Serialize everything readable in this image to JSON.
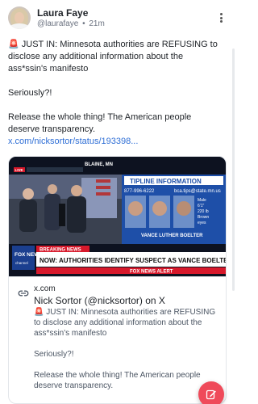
{
  "post": {
    "author_name": "Laura Faye",
    "handle": "@laurafaye",
    "separator": "•",
    "time": "21m",
    "body": [
      "🚨 JUST IN: Minnesota authorities are REFUSING to disclose any additional information about the ass*ssin's manifesto",
      "Seriously?!",
      "Release the whole thing! The American people deserve transparency."
    ],
    "link_text": "x.com/nicksortor/status/193398..."
  },
  "card": {
    "thumbnail": {
      "location": "BLAINE, MN",
      "live_badge": "LIVE",
      "panel_title": "TIPLINE INFORMATION",
      "phone": "877-996-6222",
      "email": "bca.tips@state.mn.us",
      "stats": [
        "Male",
        "6'1\"",
        "220 lb",
        "Brown",
        "eyes"
      ],
      "suspect_name": "VANCE LUTHER BOELTER",
      "breaking_label": "BREAKING NEWS",
      "headline": "NOW: AUTHORITIES IDENTIFY SUSPECT AS VANCE BOELTER",
      "network": "FOX NEWS",
      "channel": "channel",
      "alert": "FOX NEWS ALERT"
    },
    "domain": "x.com",
    "title": "Nick Sortor (@nicksortor) on X",
    "description": [
      "🚨 JUST IN: Minnesota authorities are REFUSING to disclose any additional information about the ass*ssin's manifesto",
      "Seriously?!",
      "Release the whole thing! The American people deserve transparency."
    ]
  },
  "colors": {
    "link": "#2f6fd6",
    "fab": "#ef4a5a",
    "breaking_red": "#d7192b",
    "panel_blue": "#1e4fa8"
  },
  "icons": [
    "more-vertical-icon",
    "link-icon",
    "edit-icon"
  ]
}
